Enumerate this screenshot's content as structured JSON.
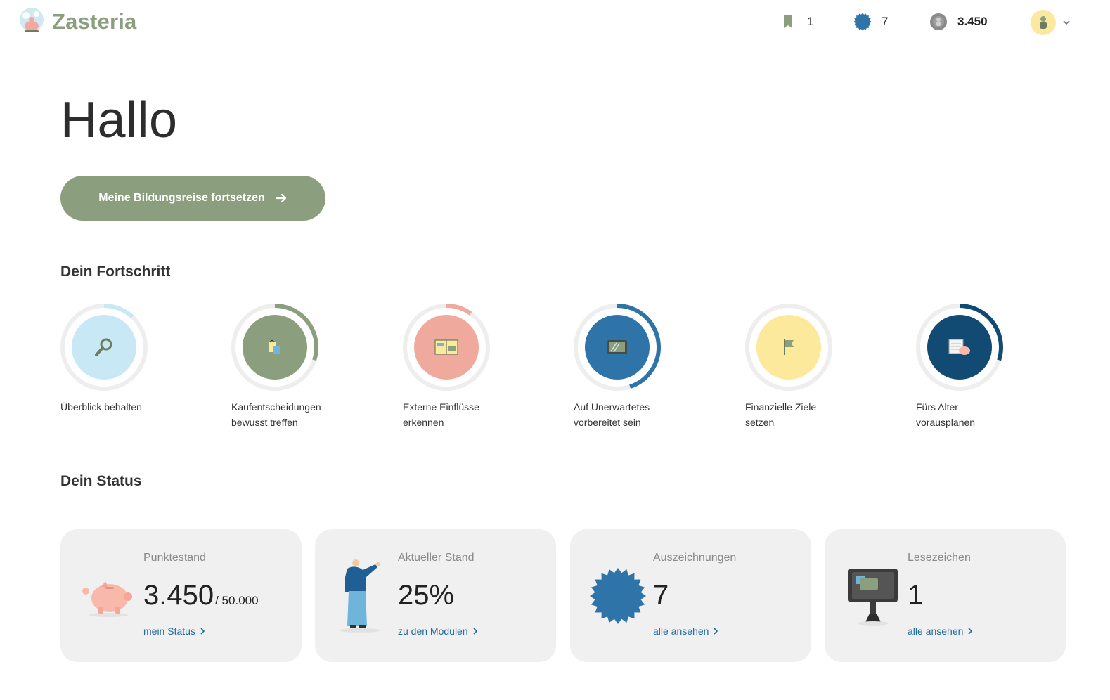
{
  "app": {
    "name": "Zasteria"
  },
  "header": {
    "bookmarks_count": "1",
    "awards_count": "7",
    "points": "3.450"
  },
  "hero": {
    "greeting": "Hallo",
    "cta_label": "Meine Bildungsreise fortsetzen"
  },
  "progress": {
    "title": "Dein Fortschritt",
    "modules": [
      {
        "label": "Überblick behalten",
        "progress": 0.12,
        "color": "#c8e8f5",
        "ring_color": "#c8e8f5",
        "icon": "magnifier-icon"
      },
      {
        "label": "Kaufentscheidungen\nbewusst treffen",
        "progress": 0.3,
        "color": "#8b9e7d",
        "ring_color": "#8b9e7d",
        "icon": "shopping-bags-icon"
      },
      {
        "label": "Externe Einflüsse\nerkennen",
        "progress": 0.1,
        "color": "#f0a99d",
        "ring_color": "#f0a99d",
        "icon": "newspapers-icon"
      },
      {
        "label": "Auf Unerwartetes\nvorbereitet sein",
        "progress": 0.45,
        "color": "#2e74a8",
        "ring_color": "#2e74a8",
        "icon": "broken-screen-icon"
      },
      {
        "label": "Finanzielle Ziele\nsetzen",
        "progress": 0.0,
        "color": "#fde99b",
        "ring_color": "#fde99b",
        "icon": "flag-icon"
      },
      {
        "label": "Fürs Alter\nvorausplanen",
        "progress": 0.3,
        "color": "#114a72",
        "ring_color": "#114a72",
        "icon": "calendar-piggy-icon"
      }
    ]
  },
  "status": {
    "title": "Dein Status",
    "cards": [
      {
        "title": "Punktestand",
        "value": "3.450",
        "sub": "/ 50.000",
        "link": "mein Status",
        "icon": "piggy-bank-icon"
      },
      {
        "title": "Aktueller Stand",
        "value": "25%",
        "sub": "",
        "link": "zu den Modulen",
        "icon": "person-pointing-icon"
      },
      {
        "title": "Auszeichnungen",
        "value": "7",
        "sub": "",
        "link": "alle ansehen",
        "icon": "award-badge-icon"
      },
      {
        "title": "Lesezeichen",
        "value": "1",
        "sub": "",
        "link": "alle ansehen",
        "icon": "monitor-icon"
      }
    ]
  }
}
